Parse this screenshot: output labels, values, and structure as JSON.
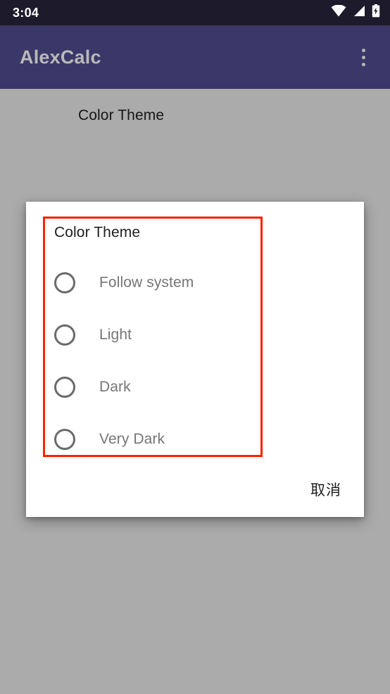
{
  "status_bar": {
    "time": "3:04",
    "icons": [
      {
        "name": "wifi-icon"
      },
      {
        "name": "cellular-signal-icon"
      },
      {
        "name": "battery-charging-icon"
      }
    ]
  },
  "app_bar": {
    "title": "AlexCalc",
    "overflow_menu_name": "overflow-menu-icon"
  },
  "page": {
    "preference_title": "Color Theme"
  },
  "dialog": {
    "title": "Color Theme",
    "options": [
      {
        "label": "Follow system",
        "selected": false
      },
      {
        "label": "Light",
        "selected": false
      },
      {
        "label": "Dark",
        "selected": false
      },
      {
        "label": "Very Dark",
        "selected": false
      }
    ],
    "cancel_label": "取消",
    "highlight_color": "#ff2200"
  },
  "colors": {
    "status_bar_bg": "#1d1b2b",
    "app_bar_bg": "#3b3768",
    "app_bar_title": "#b9b9b9",
    "scrim_bg": "#ababab",
    "dialog_bg": "#ffffff",
    "dialog_title_text": "#1f1f1f",
    "option_label_text": "#757575",
    "radio_stroke": "#6b6b6b",
    "highlight_border": "#ff2200"
  }
}
